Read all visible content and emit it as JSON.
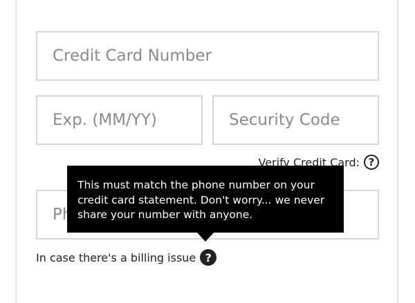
{
  "form": {
    "card_number": {
      "placeholder": "Credit Card Number",
      "value": ""
    },
    "expiration": {
      "placeholder": "Exp. (MM/YY)",
      "value": ""
    },
    "security_code": {
      "placeholder": "Security Code",
      "value": ""
    },
    "phone": {
      "placeholder": "Phone",
      "value": ""
    },
    "verify_label": "Verify Credit Card:",
    "billing_label": "In case there's a billing issue"
  },
  "icons": {
    "verify_help": {
      "name": "question-circle-outline-icon",
      "glyph": "?"
    },
    "billing_help": {
      "name": "question-circle-filled-icon",
      "glyph": "?"
    }
  },
  "tooltip": {
    "lines": [
      "This must match the phone number on your",
      "credit card statement. Don't worry... we never",
      "share your number with anyone."
    ]
  },
  "colors": {
    "tooltip_bg": "#000000",
    "border": "#d6d6d6",
    "placeholder": "#8a8a8a"
  }
}
